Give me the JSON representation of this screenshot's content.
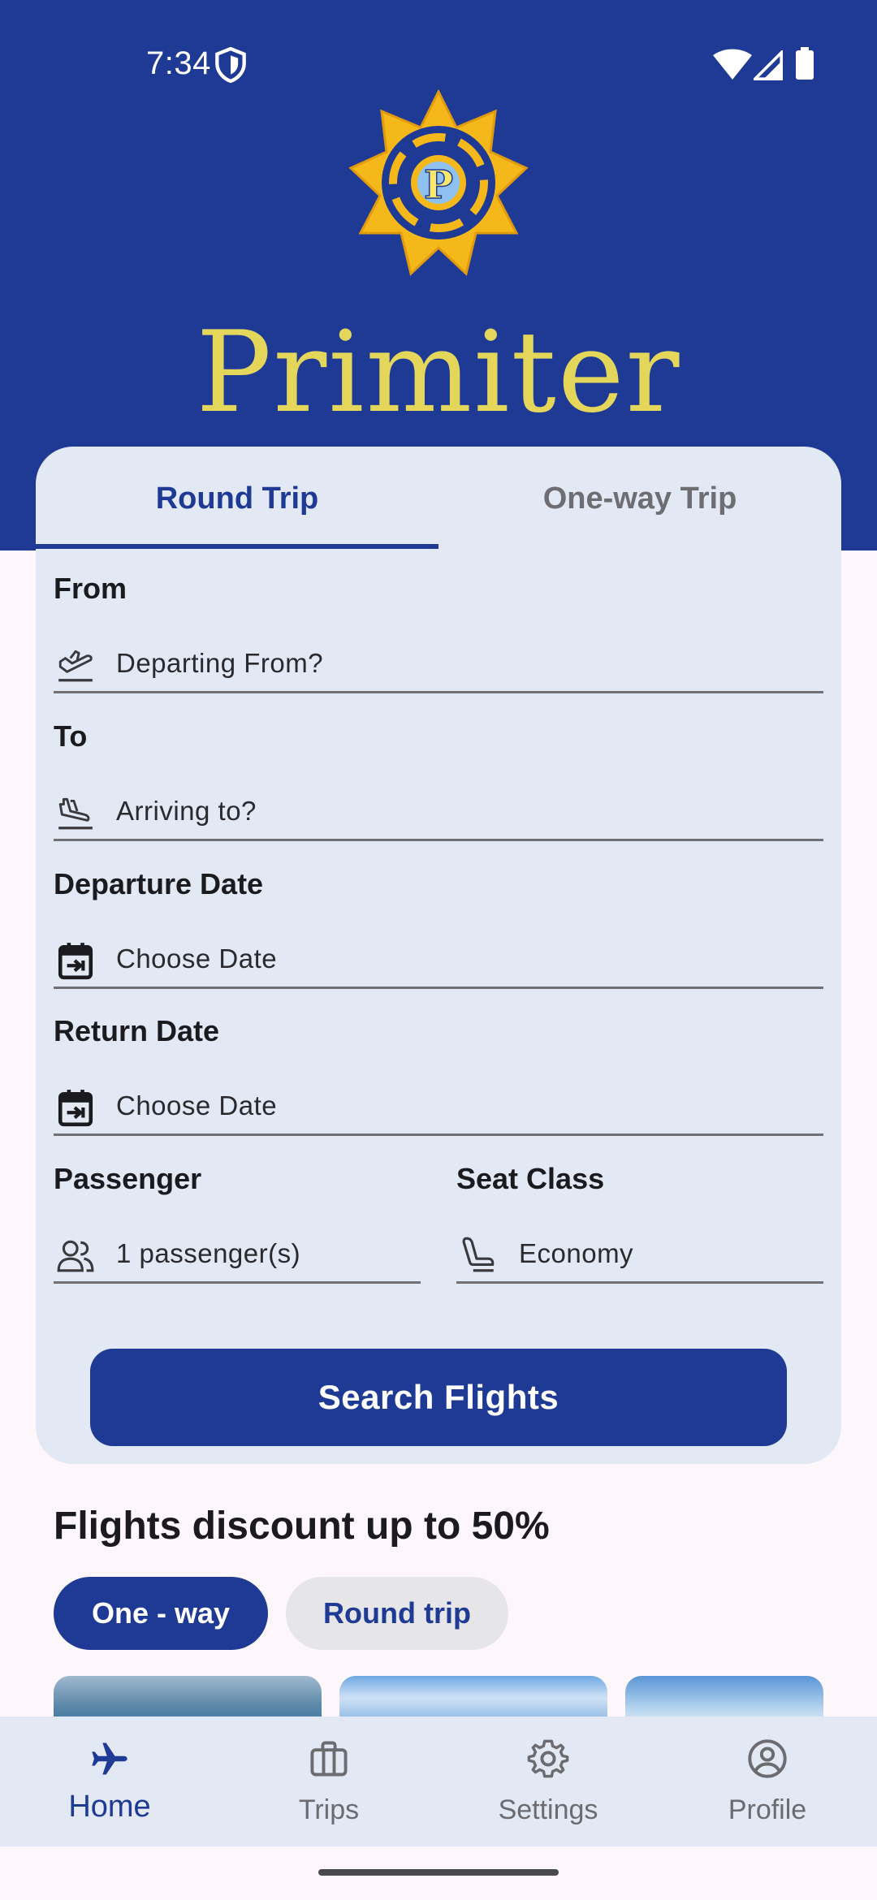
{
  "status_bar": {
    "time": "7:34"
  },
  "brand": {
    "name": "Primiter",
    "emblem_letter": "P"
  },
  "tabs": [
    {
      "label": "Round Trip",
      "active": true
    },
    {
      "label": "One-way Trip",
      "active": false
    }
  ],
  "form": {
    "from": {
      "label": "From",
      "placeholder": "Departing From?",
      "icon": "airplane-takeoff-icon"
    },
    "to": {
      "label": "To",
      "placeholder": "Arriving to?",
      "icon": "airplane-landing-icon"
    },
    "departure_date": {
      "label": "Departure Date",
      "placeholder": "Choose Date",
      "icon": "calendar-icon"
    },
    "return_date": {
      "label": "Return Date",
      "placeholder": "Choose Date",
      "icon": "calendar-icon"
    },
    "passenger": {
      "label": "Passenger",
      "value": "1 passenger(s)",
      "icon": "people-icon"
    },
    "seat_class": {
      "label": "Seat Class",
      "value": "Economy",
      "icon": "seat-icon"
    },
    "search_button": "Search Flights"
  },
  "discounts": {
    "title": "Flights discount up to 50%",
    "filters": [
      {
        "label": "One - way",
        "selected": true
      },
      {
        "label": "Round trip",
        "selected": false
      }
    ]
  },
  "bottom_nav": [
    {
      "label": "Home",
      "icon": "airplane-icon",
      "active": true
    },
    {
      "label": "Trips",
      "icon": "briefcase-icon",
      "active": false
    },
    {
      "label": "Settings",
      "icon": "gear-icon",
      "active": false
    },
    {
      "label": "Profile",
      "icon": "user-circle-icon",
      "active": false
    }
  ],
  "colors": {
    "primary": "#1e3a94",
    "card_background": "#e3e8f5",
    "brand_gold": "#e3d65a",
    "emblem_gold": "#f5b81a",
    "page_background": "#fdf7fc"
  }
}
